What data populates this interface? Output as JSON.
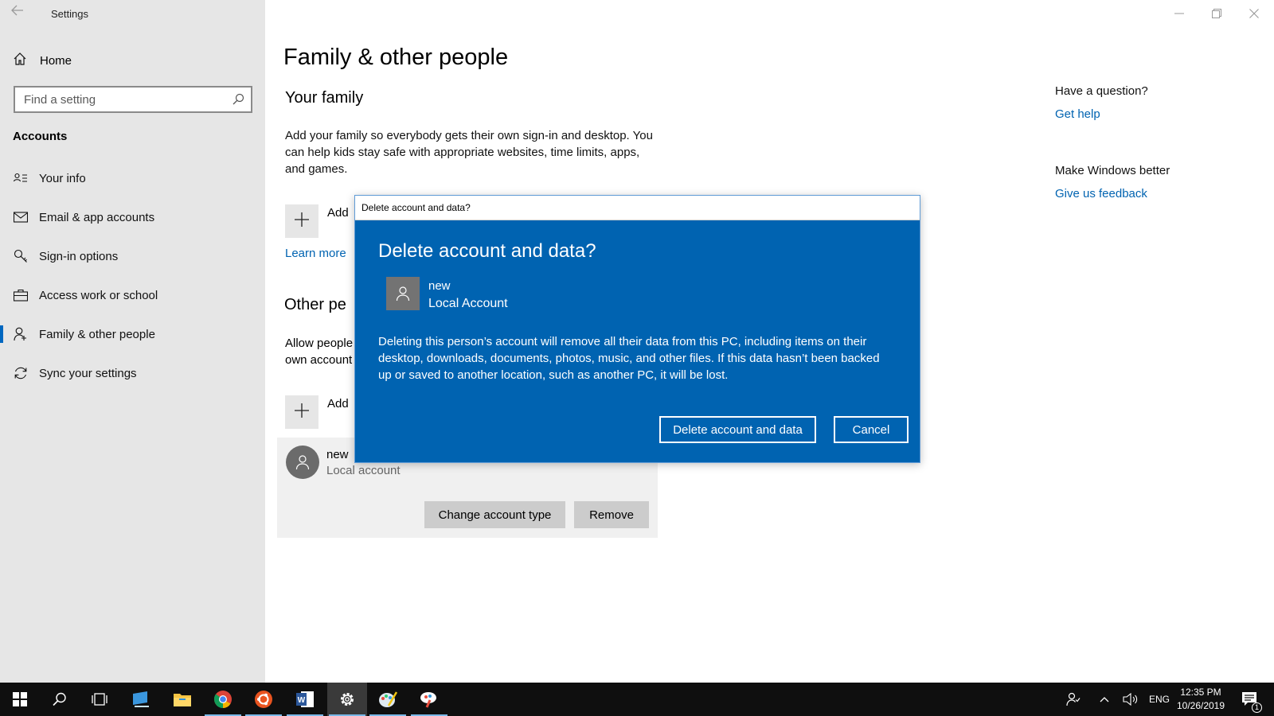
{
  "window": {
    "title": "Settings"
  },
  "sidebar": {
    "home_label": "Home",
    "search_placeholder": "Find a setting",
    "section_title": "Accounts",
    "items": [
      {
        "label": "Your info",
        "icon": "contact-card-icon"
      },
      {
        "label": "Email & app accounts",
        "icon": "mail-icon"
      },
      {
        "label": "Sign-in options",
        "icon": "key-icon"
      },
      {
        "label": "Access work or school",
        "icon": "briefcase-icon"
      },
      {
        "label": "Family & other people",
        "icon": "person-add-icon",
        "active": true
      },
      {
        "label": "Sync your settings",
        "icon": "sync-icon"
      }
    ]
  },
  "main": {
    "page_title": "Family & other people",
    "family_title": "Your family",
    "family_text": "Add your family so everybody gets their own sign-in and desktop. You can help kids stay safe with appropriate websites, time limits, apps, and games.",
    "add_family_label": "Add",
    "learn_more": "Learn more",
    "other_title": "Other pe",
    "other_text": "Allow people own account",
    "add_other_label": "Add",
    "user": {
      "name": "new",
      "type": "Local account"
    },
    "change_type_button": "Change account type",
    "remove_button": "Remove"
  },
  "right_pane": {
    "question_heading": "Have a question?",
    "get_help": "Get help",
    "better_heading": "Make Windows better",
    "feedback": "Give us feedback"
  },
  "dialog": {
    "titlebar": "Delete account and data?",
    "heading": "Delete account and data?",
    "user_name": "new",
    "account_type": "Local Account",
    "message": "Deleting this person’s account will remove all their data from this PC, including items on their desktop, downloads, documents, photos, music, and other files. If this data hasn’t been backed up or saved to another location, such as another PC, it will be lost.",
    "confirm_button": "Delete account and data",
    "cancel_button": "Cancel"
  },
  "taskbar": {
    "language": "ENG",
    "time": "12:35 PM",
    "date": "10/26/2019",
    "notification_count": "1"
  },
  "colors": {
    "accent": "#0063b1",
    "sidebar_bg": "#e6e6e6",
    "taskbar_bg": "#0f0f0f"
  }
}
